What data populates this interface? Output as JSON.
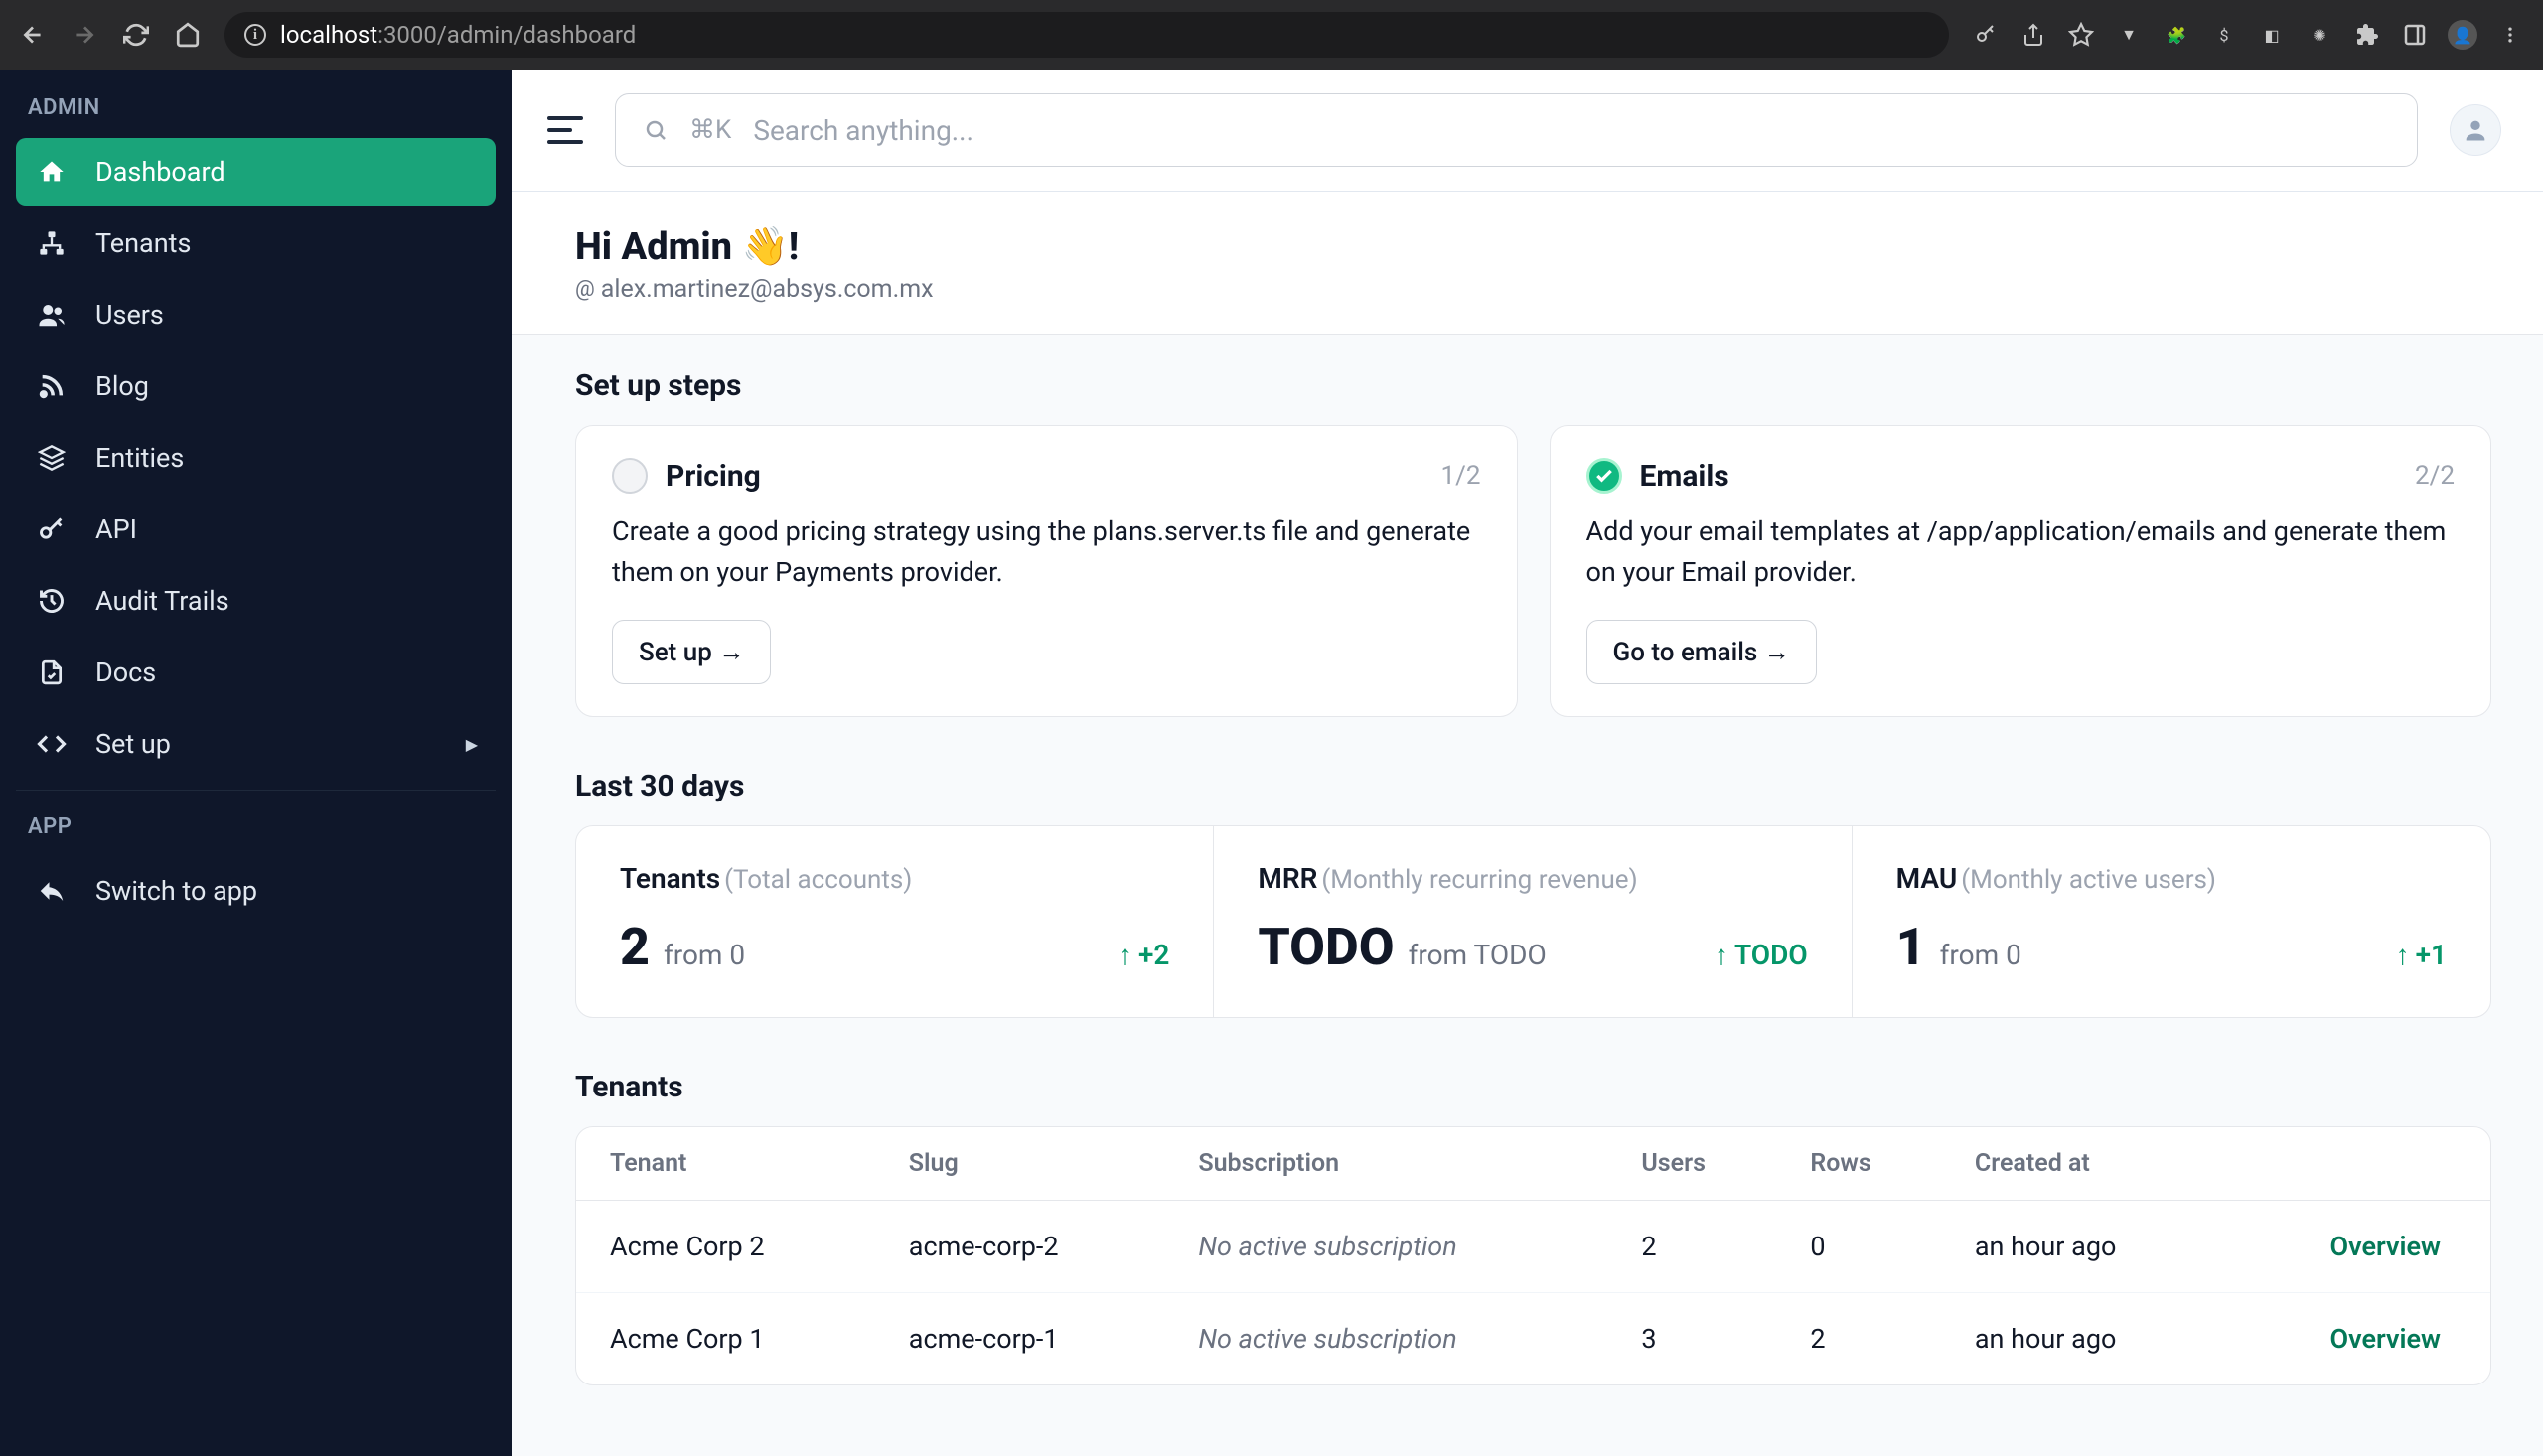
{
  "browser": {
    "url_host": "localhost",
    "url_port_path": ":3000/admin/dashboard"
  },
  "sidebar": {
    "admin_label": "ADMIN",
    "app_label": "APP",
    "items": [
      {
        "label": "Dashboard",
        "icon": "home"
      },
      {
        "label": "Tenants",
        "icon": "sitemap"
      },
      {
        "label": "Users",
        "icon": "users"
      },
      {
        "label": "Blog",
        "icon": "rss"
      },
      {
        "label": "Entities",
        "icon": "cube"
      },
      {
        "label": "API",
        "icon": "key"
      },
      {
        "label": "Audit Trails",
        "icon": "history"
      },
      {
        "label": "Docs",
        "icon": "file"
      },
      {
        "label": "Set up",
        "icon": "code"
      }
    ],
    "switch_label": "Switch to app"
  },
  "search": {
    "shortcut": "⌘K",
    "placeholder": "Search anything..."
  },
  "header": {
    "greeting": "Hi Admin 👋!",
    "email": "alex.martinez@absys.com.mx"
  },
  "setup": {
    "title": "Set up steps",
    "cards": [
      {
        "title": "Pricing",
        "count": "1/2",
        "desc": "Create a good pricing strategy using the plans.server.ts file and generate them on your Payments provider.",
        "button": "Set up →",
        "done": false
      },
      {
        "title": "Emails",
        "count": "2/2",
        "desc": "Add your email templates at /app/application/emails and generate them on your Email provider.",
        "button": "Go to emails →",
        "done": true
      }
    ]
  },
  "stats": {
    "title": "Last 30 days",
    "items": [
      {
        "label": "Tenants",
        "sublabel": "(Total accounts)",
        "value": "2",
        "from": "from 0",
        "delta": "+2"
      },
      {
        "label": "MRR",
        "sublabel": "(Monthly recurring revenue)",
        "value": "TODO",
        "from": "from TODO",
        "delta": "TODO"
      },
      {
        "label": "MAU",
        "sublabel": "(Monthly active users)",
        "value": "1",
        "from": "from 0",
        "delta": "+1"
      }
    ]
  },
  "tenants": {
    "title": "Tenants",
    "columns": [
      "Tenant",
      "Slug",
      "Subscription",
      "Users",
      "Rows",
      "Created at",
      ""
    ],
    "rows": [
      {
        "name": "Acme Corp 2",
        "slug": "acme-corp-2",
        "sub": "No active subscription",
        "users": "2",
        "rows": "0",
        "created": "an hour ago",
        "action": "Overview"
      },
      {
        "name": "Acme Corp 1",
        "slug": "acme-corp-1",
        "sub": "No active subscription",
        "users": "3",
        "rows": "2",
        "created": "an hour ago",
        "action": "Overview"
      }
    ]
  }
}
